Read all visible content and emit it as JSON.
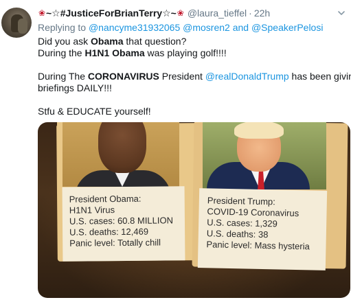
{
  "tweet": {
    "display_name": "~☆#JusticeForBrianTerry☆~",
    "handle": "@laura_tieffel",
    "separator": "·",
    "time": "22h",
    "replying_prefix": "Replying to",
    "replying_users": [
      "@nancyme31932065",
      "@mosren2"
    ],
    "replying_and": "and",
    "replying_last": "@SpeakerPelosi",
    "lines": {
      "l1_pre": "Did you ask ",
      "l1_bold": "Obama",
      "l1_post": " that question?",
      "l2_pre": "During the ",
      "l2_bold1": "H1N1",
      "l2_space": " ",
      "l2_bold2": "Obama",
      "l2_post": " was playing golf!!!!",
      "l3_pre": "During The ",
      "l3_bold": "CORONAVIRUS",
      "l3_mid": " President ",
      "l3_link": "@realDonaldTrump",
      "l3_post": " has been giving",
      "l4": "briefings DAILY!!!",
      "l5": "Stfu & EDUCATE yourself!"
    }
  },
  "image": {
    "left_card": {
      "title": "President Obama:",
      "virus": "H1N1 Virus",
      "cases": "U.S. cases: 60.8 MILLION",
      "deaths": "U.S. deaths: 12,469",
      "panic": "Panic level: Totally chill"
    },
    "right_card": {
      "title": "President Trump:",
      "virus": "COVID-19 Coronavirus",
      "cases": "U.S. cases: 1,329",
      "deaths": "U.S. deaths: 38",
      "panic": "Panic level: Mass hysteria"
    }
  },
  "colors": {
    "link": "#1b95e0",
    "muted": "#657786",
    "rose": "#c0172b"
  },
  "icons": [
    "rose-icon",
    "chevron-down-icon"
  ]
}
